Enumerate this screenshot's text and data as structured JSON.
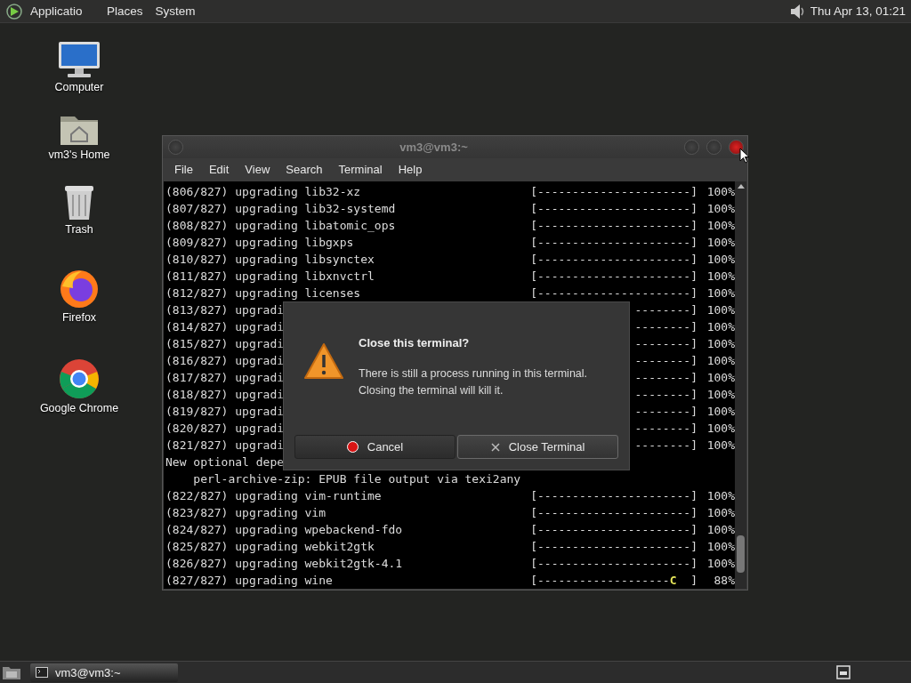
{
  "top_panel": {
    "menus": [
      "Applicatio",
      "Places",
      "System"
    ],
    "clock": "Thu Apr 13, 01:21"
  },
  "desktop_icons": [
    {
      "label": "Computer",
      "kind": "computer"
    },
    {
      "label": "vm3's Home",
      "kind": "home"
    },
    {
      "label": "Trash",
      "kind": "trash"
    },
    {
      "label": "Firefox",
      "kind": "firefox"
    },
    {
      "label": "Google Chrome",
      "kind": "chrome"
    }
  ],
  "window": {
    "title": "vm3@vm3:~",
    "menu": [
      "File",
      "Edit",
      "View",
      "Search",
      "Terminal",
      "Help"
    ],
    "lines": [
      {
        "kind": "progress",
        "text": "(806/827) upgrading lib32-xz",
        "bar": "[----------------------]",
        "percent": "100%"
      },
      {
        "kind": "progress",
        "text": "(807/827) upgrading lib32-systemd",
        "bar": "[----------------------]",
        "percent": "100%"
      },
      {
        "kind": "progress",
        "text": "(808/827) upgrading libatomic_ops",
        "bar": "[----------------------]",
        "percent": "100%"
      },
      {
        "kind": "progress",
        "text": "(809/827) upgrading libgxps",
        "bar": "[----------------------]",
        "percent": "100%"
      },
      {
        "kind": "progress",
        "text": "(810/827) upgrading libsynctex",
        "bar": "[----------------------]",
        "percent": "100%"
      },
      {
        "kind": "progress",
        "text": "(811/827) upgrading libxnvctrl",
        "bar": "[----------------------]",
        "percent": "100%"
      },
      {
        "kind": "progress",
        "text": "(812/827) upgrading licenses",
        "bar": "[----------------------]",
        "percent": "100%"
      },
      {
        "kind": "progress",
        "text": "(813/827) upgradi",
        "bar": "--------]",
        "percent": "100%"
      },
      {
        "kind": "progress",
        "text": "(814/827) upgradi",
        "bar": "--------]",
        "percent": "100%"
      },
      {
        "kind": "progress",
        "text": "(815/827) upgradi",
        "bar": "--------]",
        "percent": "100%"
      },
      {
        "kind": "progress",
        "text": "(816/827) upgradi",
        "bar": "--------]",
        "percent": "100%"
      },
      {
        "kind": "progress",
        "text": "(817/827) upgradi",
        "bar": "--------]",
        "percent": "100%"
      },
      {
        "kind": "progress",
        "text": "(818/827) upgradi",
        "bar": "--------]",
        "percent": "100%"
      },
      {
        "kind": "progress",
        "text": "(819/827) upgradi",
        "bar": "--------]",
        "percent": "100%"
      },
      {
        "kind": "progress",
        "text": "(820/827) upgradi",
        "bar": "--------]",
        "percent": "100%"
      },
      {
        "kind": "progress",
        "text": "(821/827) upgradi",
        "bar": "--------]",
        "percent": "100%"
      },
      {
        "kind": "text",
        "text": "New optional depe"
      },
      {
        "kind": "text",
        "text": "    perl-archive-zip: EPUB file output via texi2any"
      },
      {
        "kind": "progress",
        "text": "(822/827) upgrading vim-runtime",
        "bar": "[----------------------]",
        "percent": "100%"
      },
      {
        "kind": "progress",
        "text": "(823/827) upgrading vim",
        "bar": "[----------------------]",
        "percent": "100%"
      },
      {
        "kind": "progress",
        "text": "(824/827) upgrading wpebackend-fdo",
        "bar": "[----------------------]",
        "percent": "100%"
      },
      {
        "kind": "progress",
        "text": "(825/827) upgrading webkit2gtk",
        "bar": "[----------------------]",
        "percent": "100%"
      },
      {
        "kind": "progress",
        "text": "(826/827) upgrading webkit2gtk-4.1",
        "bar": "[----------------------]",
        "percent": "100%"
      },
      {
        "kind": "progress",
        "text": "(827/827) upgrading wine",
        "bar": "[-------------------",
        "pacman": "C",
        "bar_end": "  ]",
        "percent": "88%"
      }
    ],
    "dialog": {
      "title": "Close this terminal?",
      "message": "There is still a process running in this terminal. Closing the terminal will kill it.",
      "buttons": [
        {
          "label": "Cancel",
          "kind": "cancel",
          "selected": false
        },
        {
          "label": "Close Terminal",
          "kind": "close",
          "selected": true
        }
      ]
    }
  },
  "taskbar": {
    "tasks": [
      {
        "label": "vm3@vm3:~",
        "selected": true
      }
    ]
  }
}
